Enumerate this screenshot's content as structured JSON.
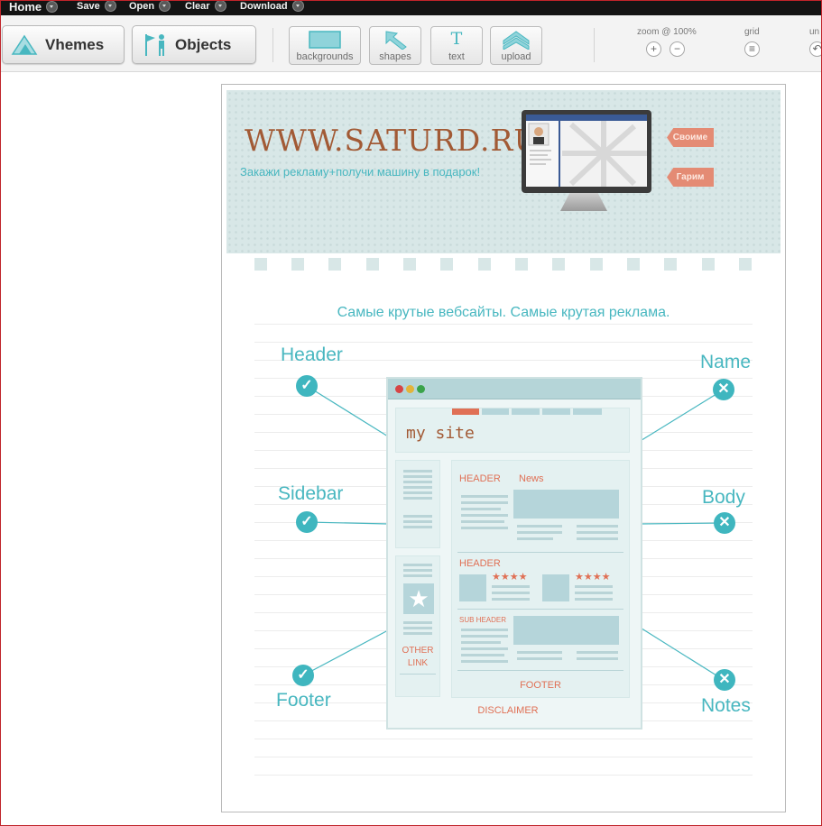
{
  "menu": {
    "home": "Home",
    "save": "Save",
    "open": "Open",
    "clear": "Clear",
    "download": "Download"
  },
  "toolbar": {
    "themes_label": "Vhemes",
    "objects_label": "Objects",
    "backgrounds_label": "backgrounds",
    "shapes_label": "shapes",
    "text_label": "text",
    "upload_label": "upload",
    "zoom_label": "zoom @ 100%",
    "zoom_in": "+",
    "zoom_out": "−",
    "grid_label": "grid",
    "undo_label": "un"
  },
  "canvas": {
    "site_url": "WWW.SATURD.RU",
    "slogan": "Закажи рекламу+получи машину в подарок!",
    "tag_top": "Своиме",
    "tag_bottom": "Гарим",
    "tagline": "Самые крутые вебсайты. Самые крутая реклама.",
    "labels": {
      "header": "Header",
      "name": "Name",
      "sidebar": "Sidebar",
      "body": "Body",
      "footer": "Footer",
      "notes": "Notes"
    },
    "wireframe": {
      "site_title": "my site",
      "header1": "HEADER",
      "news": "News",
      "header2": "HEADER",
      "sub_header": "SUB HEADER",
      "other_link": "OTHER LINK",
      "footer": "FOOTER",
      "disclaimer": "DISCLAIMER",
      "stars": "★★★★"
    }
  },
  "colors": {
    "accent_cyan": "#48b7c0",
    "url_brown": "#a25a35",
    "wire_orange": "#e07055",
    "tag_salmon": "#e48b74",
    "menubar": "#141414"
  },
  "icons": {
    "check": "check-circle-icon",
    "cross": "x-circle-icon"
  }
}
